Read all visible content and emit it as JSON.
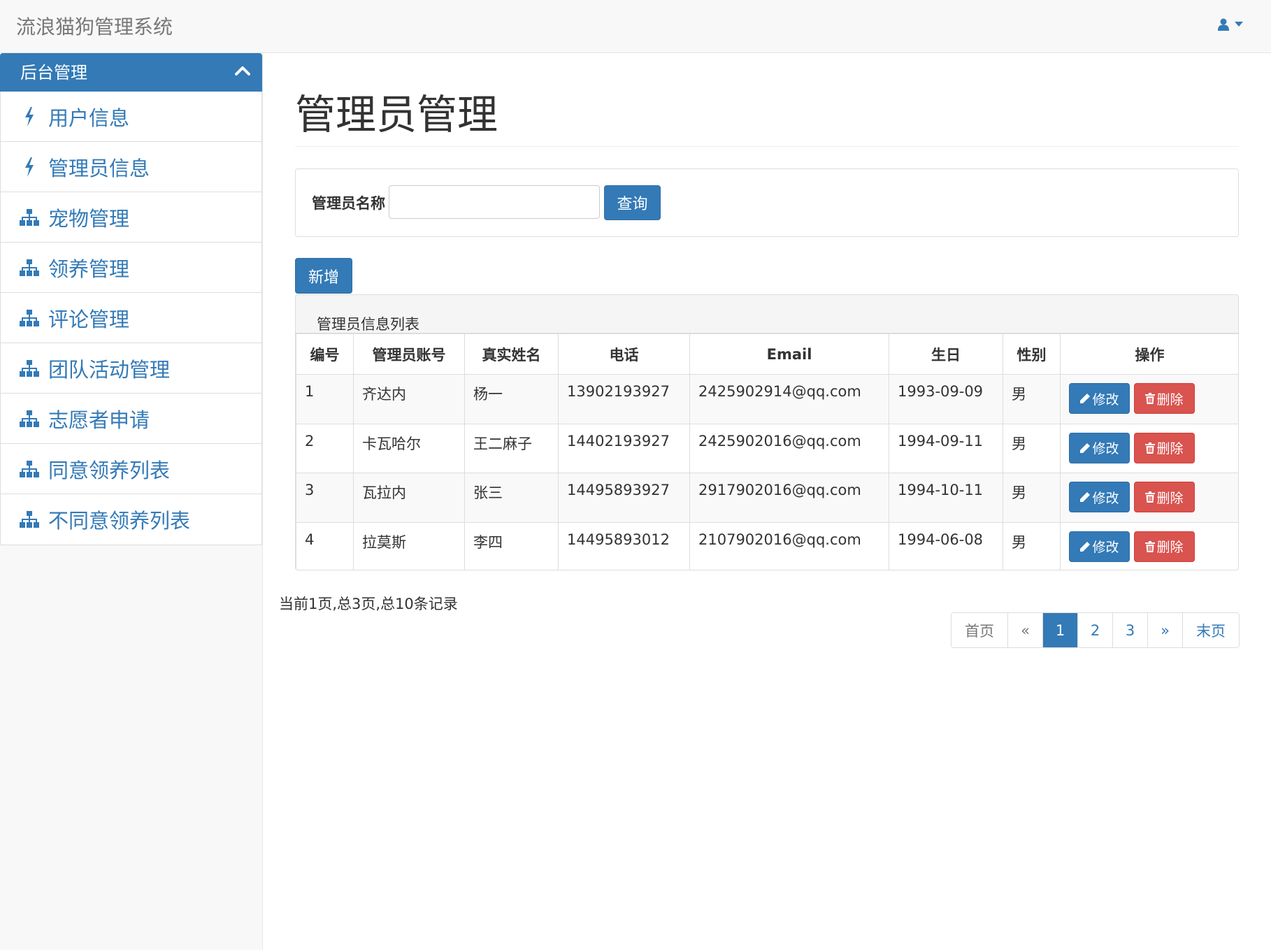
{
  "app": {
    "brand": "流浪猫狗管理系统"
  },
  "navbar": {
    "user_icon": "user-icon",
    "caret_icon": "caret-down-icon"
  },
  "sidebar": {
    "header": "后台管理",
    "items": [
      {
        "label": "用户信息",
        "icon": "bolt-icon"
      },
      {
        "label": "管理员信息",
        "icon": "bolt-icon"
      },
      {
        "label": "宠物管理",
        "icon": "sitemap-icon"
      },
      {
        "label": "领养管理",
        "icon": "sitemap-icon"
      },
      {
        "label": "评论管理",
        "icon": "sitemap-icon"
      },
      {
        "label": "团队活动管理",
        "icon": "sitemap-icon"
      },
      {
        "label": "志愿者申请",
        "icon": "sitemap-icon"
      },
      {
        "label": "同意领养列表",
        "icon": "sitemap-icon"
      },
      {
        "label": "不同意领养列表",
        "icon": "sitemap-icon"
      }
    ]
  },
  "page": {
    "title": "管理员管理",
    "search_label": "管理员名称",
    "search_value": "",
    "search_button": "查询",
    "add_button": "新增",
    "table_title": "管理员信息列表"
  },
  "table": {
    "columns": [
      "编号",
      "管理员账号",
      "真实姓名",
      "电话",
      "Email",
      "生日",
      "性别",
      "操作"
    ],
    "rows": [
      {
        "id": "1",
        "account": "齐达内",
        "name": "杨一",
        "phone": "13902193927",
        "email": "2425902914@qq.com",
        "birthday": "1993-09-09",
        "gender": "男"
      },
      {
        "id": "2",
        "account": "卡瓦哈尔",
        "name": "王二麻子",
        "phone": "14402193927",
        "email": "2425902016@qq.com",
        "birthday": "1994-09-11",
        "gender": "男"
      },
      {
        "id": "3",
        "account": "瓦拉内",
        "name": "张三",
        "phone": "14495893927",
        "email": "2917902016@qq.com",
        "birthday": "1994-10-11",
        "gender": "男"
      },
      {
        "id": "4",
        "account": "拉莫斯",
        "name": "李四",
        "phone": "14495893012",
        "email": "2107902016@qq.com",
        "birthday": "1994-06-08",
        "gender": "男"
      }
    ],
    "edit_label": "修改",
    "delete_label": "删除"
  },
  "pagination": {
    "summary": "当前1页,总3页,总10条记录",
    "first": "首页",
    "prev": "«",
    "pages": [
      "1",
      "2",
      "3"
    ],
    "active_page": "1",
    "next": "»",
    "last": "末页"
  },
  "colors": {
    "primary": "#337ab7",
    "danger": "#d9534f"
  }
}
